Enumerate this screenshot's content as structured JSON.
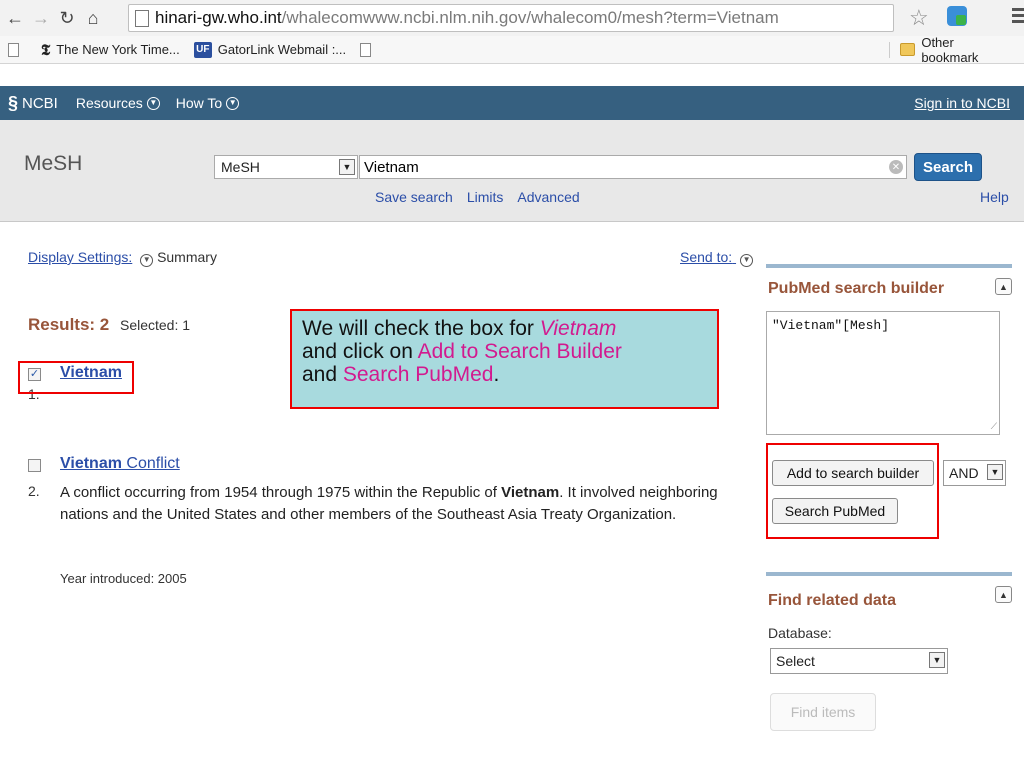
{
  "browser": {
    "url_host": "hinari-gw.who.int",
    "url_path": "/whalecomwww.ncbi.nlm.nih.gov/whalecom0/mesh?term=Vietnam",
    "bookmarks": [
      "The New York Time...",
      "GatorLink Webmail :..."
    ],
    "uf_badge": "UF",
    "other_bookmarks": "Other bookmark"
  },
  "ncbi": {
    "logo": "NCBI",
    "resources": "Resources",
    "howto": "How To",
    "signin": "Sign in to NCBI"
  },
  "search": {
    "db_title": "MeSH",
    "db_select": "MeSH",
    "term": "Vietnam",
    "button": "Search",
    "links": [
      "Save search",
      "Limits",
      "Advanced"
    ],
    "help": "Help"
  },
  "main": {
    "display_settings_label": "Display Settings:",
    "display_settings_value": "Summary",
    "send_to": "Send to:",
    "results_label": "Results: 2",
    "selected_label": "Selected: 1",
    "items": [
      {
        "num": "1.",
        "title": "Vietnam",
        "checked": true
      },
      {
        "num": "2.",
        "title_bold": "Vietnam",
        "title_rest": " Conflict",
        "checked": false,
        "desc_pre": "A conflict occurring from 1954 through 1975 within the Republic of ",
        "desc_bold": "Vietnam",
        "desc_post": ". It involved neighboring nations and the United States and other members of the Southeast Asia Treaty Organization.",
        "year": "Year introduced: 2005"
      }
    ]
  },
  "callout": {
    "t1": "We will check the box for ",
    "t2": "Vietnam",
    "t3": "and click on ",
    "t4": "Add to Search Builder",
    "t5": "and ",
    "t6": "Search PubMed",
    "t7": "."
  },
  "builder": {
    "title": "PubMed search builder",
    "query": "\"Vietnam\"[Mesh]",
    "add_btn": "Add to search builder",
    "operator": "AND",
    "search_btn": "Search PubMed"
  },
  "related": {
    "title": "Find related data",
    "db_label": "Database:",
    "db_value": "Select",
    "find_btn": "Find items"
  },
  "colors": {
    "ncbi_bar": "#366080",
    "highlight_border": "#ee0000",
    "callout_bg": "#a8dade",
    "accent_pink": "#d21a8f",
    "result_brown": "#98553a"
  }
}
